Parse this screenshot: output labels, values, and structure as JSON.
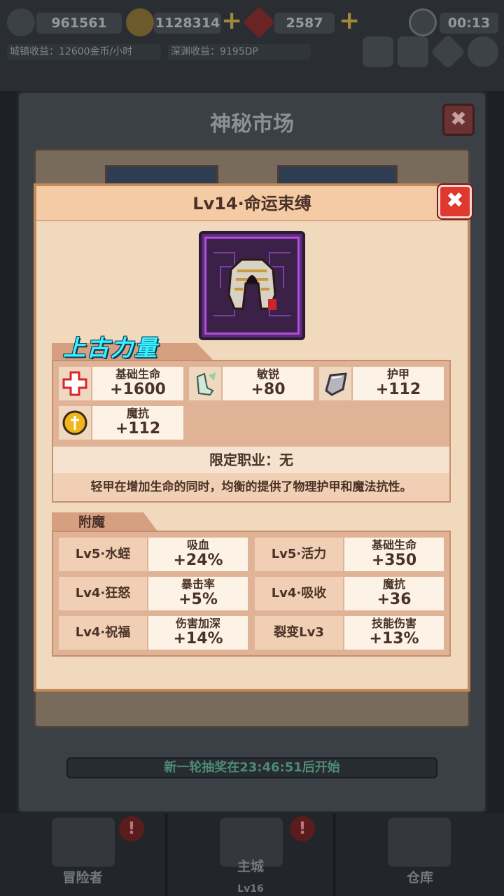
{
  "topbar": {
    "coins_a": "961561",
    "coins_b": "1128314",
    "gems": "2587",
    "timer": "00:13",
    "town_income": "城镇收益：12600金币/小时",
    "abyss_income": "深渊收益：9195DP",
    "plus_glyph": "+"
  },
  "market": {
    "title": "神秘市场",
    "close_glyph": "✖",
    "draw_notice": "新一轮抽奖在23:46:51后开始"
  },
  "nav": {
    "adventurer": "冒险者",
    "main_city": "主城",
    "main_city_level": "Lv16",
    "warehouse": "仓库",
    "badge_glyph": "!"
  },
  "item": {
    "title": "Lv14·命运束缚",
    "close_glyph": "✖",
    "set_name": "上古力量",
    "stats": [
      {
        "name": "基础生命",
        "value": "+1600",
        "icon": "red-cross-icon"
      },
      {
        "name": "敏锐",
        "value": "+80",
        "icon": "boots-icon"
      },
      {
        "name": "护甲",
        "value": "+112",
        "icon": "shield-icon"
      },
      {
        "name": "魔抗",
        "value": "+112",
        "icon": "magic-resist-icon"
      }
    ],
    "job": "限定职业：无",
    "description": "轻甲在增加生命的同时，均衡的提供了物理护甲和魔法抗性。"
  },
  "enchant": {
    "label": "附魔",
    "rows": [
      {
        "name": "Lv5·水蛭",
        "stat": "吸血",
        "value": "+24%"
      },
      {
        "name": "Lv5·活力",
        "stat": "基础生命",
        "value": "+350"
      },
      {
        "name": "Lv4·狂怒",
        "stat": "暴击率",
        "value": "+5%"
      },
      {
        "name": "Lv4·吸收",
        "stat": "魔抗",
        "value": "+36"
      },
      {
        "name": "Lv4·祝福",
        "stat": "伤害加深",
        "value": "+14%"
      },
      {
        "name": "裂变Lv3",
        "stat": "技能伤害",
        "value": "+13%"
      }
    ]
  }
}
